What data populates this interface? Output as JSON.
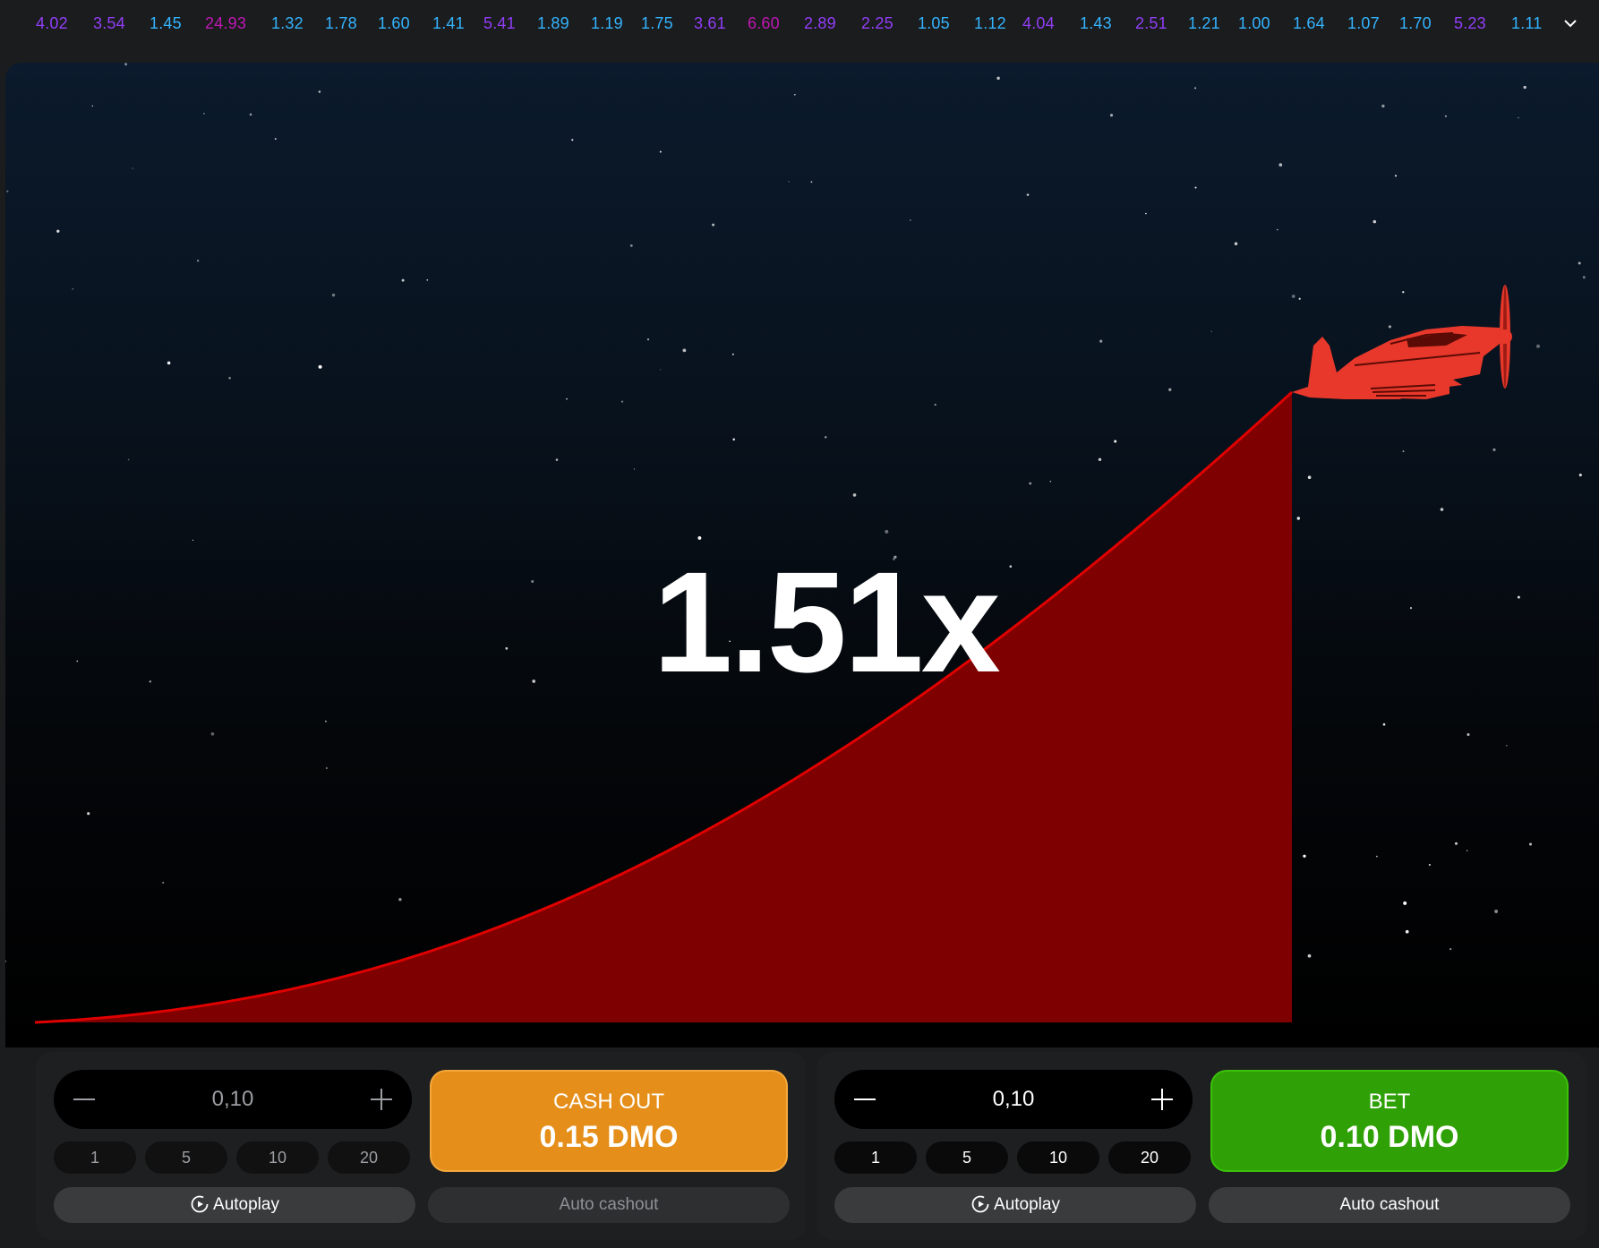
{
  "history": {
    "multipliers": [
      {
        "value": "4.02",
        "color": "#913ef8"
      },
      {
        "value": "3.54",
        "color": "#913ef8"
      },
      {
        "value": "1.45",
        "color": "#34b4ff"
      },
      {
        "value": "24.93",
        "color": "#c017b4"
      },
      {
        "value": "1.32",
        "color": "#34b4ff"
      },
      {
        "value": "1.78",
        "color": "#34b4ff"
      },
      {
        "value": "1.60",
        "color": "#34b4ff"
      },
      {
        "value": "1.41",
        "color": "#34b4ff"
      },
      {
        "value": "5.41",
        "color": "#913ef8"
      },
      {
        "value": "1.89",
        "color": "#34b4ff"
      },
      {
        "value": "1.19",
        "color": "#34b4ff"
      },
      {
        "value": "1.75",
        "color": "#34b4ff"
      },
      {
        "value": "3.61",
        "color": "#913ef8"
      },
      {
        "value": "6.60",
        "color": "#c017b4"
      },
      {
        "value": "2.89",
        "color": "#913ef8"
      },
      {
        "value": "2.25",
        "color": "#913ef8"
      },
      {
        "value": "1.05",
        "color": "#34b4ff"
      },
      {
        "value": "1.12",
        "color": "#34b4ff"
      },
      {
        "value": "4.04",
        "color": "#913ef8"
      },
      {
        "value": "1.43",
        "color": "#34b4ff"
      },
      {
        "value": "2.51",
        "color": "#913ef8"
      },
      {
        "value": "1.21",
        "color": "#34b4ff"
      },
      {
        "value": "1.00",
        "color": "#34b4ff"
      },
      {
        "value": "1.64",
        "color": "#34b4ff"
      },
      {
        "value": "1.07",
        "color": "#34b4ff"
      },
      {
        "value": "1.70",
        "color": "#34b4ff"
      },
      {
        "value": "5.23",
        "color": "#913ef8"
      },
      {
        "value": "1.11",
        "color": "#34b4ff"
      }
    ]
  },
  "game": {
    "multiplier": "1.51x",
    "curve_color": "#e00000",
    "fill_color": "#7e0000",
    "plane_color": "#e8382b"
  },
  "panels": [
    {
      "amount": "0,10",
      "quick_values": [
        "1",
        "5",
        "10",
        "20"
      ],
      "action_line1": "CASH OUT",
      "action_line2": "0.15 DMO",
      "action_color": "#e58f1a",
      "autoplay_label": "Autoplay",
      "autocashout_label": "Auto cashout"
    },
    {
      "amount": "0,10",
      "quick_values": [
        "1",
        "5",
        "10",
        "20"
      ],
      "action_line1": "BET",
      "action_line2": "0.10 DMO",
      "action_color": "#2fa106",
      "autoplay_label": "Autoplay",
      "autocashout_label": "Auto cashout"
    }
  ]
}
